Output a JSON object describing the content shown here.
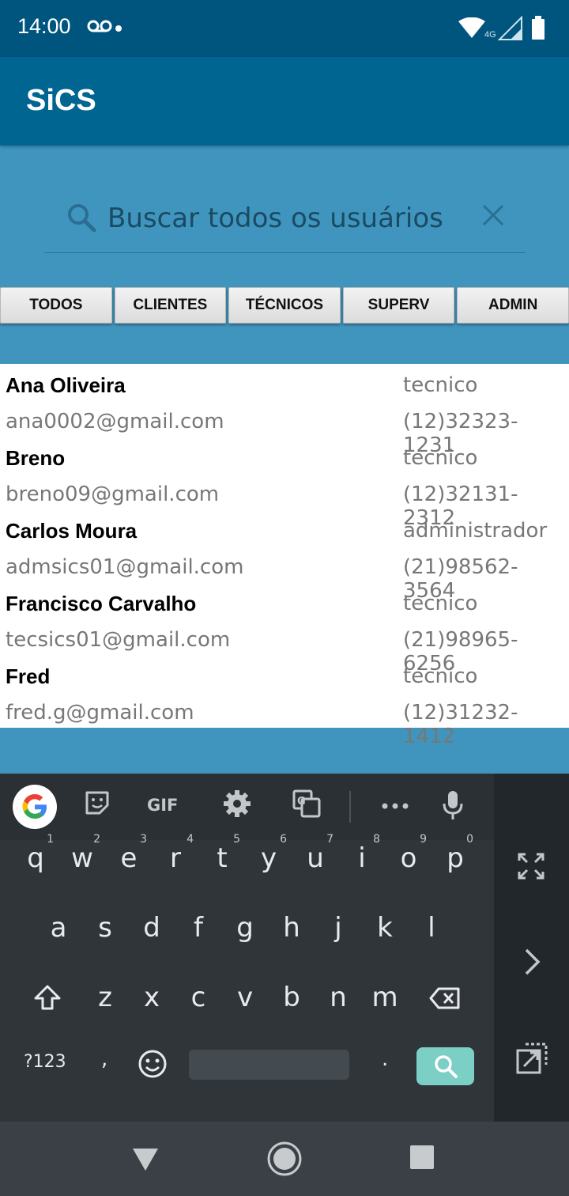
{
  "status_bar": {
    "time": "14:00",
    "network": "4G"
  },
  "app_bar": {
    "title": "SiCS"
  },
  "search": {
    "placeholder": "Buscar todos os usuários"
  },
  "tabs": [
    "TODOS",
    "CLIENTES",
    "TÉCNICOS",
    "SUPERV",
    "ADMIN"
  ],
  "users": [
    {
      "name": "Ana Oliveira",
      "role": "tecnico",
      "email": "ana0002@gmail.com",
      "phone": "(12)32323-1231"
    },
    {
      "name": "Breno",
      "role": "tecnico",
      "email": "breno09@gmail.com",
      "phone": "(12)32131-2312"
    },
    {
      "name": "Carlos Moura",
      "role": "administrador",
      "email": "admsics01@gmail.com",
      "phone": "(21)98562-3564"
    },
    {
      "name": "Francisco Carvalho",
      "role": "tecnico",
      "email": "tecsics01@gmail.com",
      "phone": "(21)98965-6256"
    },
    {
      "name": "Fred",
      "role": "tecnico",
      "email": "fred.g@gmail.com",
      "phone": "(12)31232-1412"
    }
  ],
  "keyboard": {
    "toolbar": [
      "google-icon",
      "sticker-icon",
      "gif-icon",
      "settings-icon",
      "translate-icon",
      "more-icon",
      "mic-icon"
    ],
    "row1": [
      {
        "k": "q",
        "n": "1"
      },
      {
        "k": "w",
        "n": "2"
      },
      {
        "k": "e",
        "n": "3"
      },
      {
        "k": "r",
        "n": "4"
      },
      {
        "k": "t",
        "n": "5"
      },
      {
        "k": "y",
        "n": "6"
      },
      {
        "k": "u",
        "n": "7"
      },
      {
        "k": "i",
        "n": "8"
      },
      {
        "k": "o",
        "n": "9"
      },
      {
        "k": "p",
        "n": "0"
      }
    ],
    "row2": [
      "a",
      "s",
      "d",
      "f",
      "g",
      "h",
      "j",
      "k",
      "l"
    ],
    "row3": [
      "z",
      "x",
      "c",
      "v",
      "b",
      "n",
      "m"
    ],
    "symbols_label": "?123",
    "comma": ",",
    "period": "."
  },
  "colors": {
    "status_bar": "#00557F",
    "app_bar": "#006591",
    "background": "#4095BE",
    "keyboard": "#2F3539",
    "search_key": "#7BCFC5"
  }
}
